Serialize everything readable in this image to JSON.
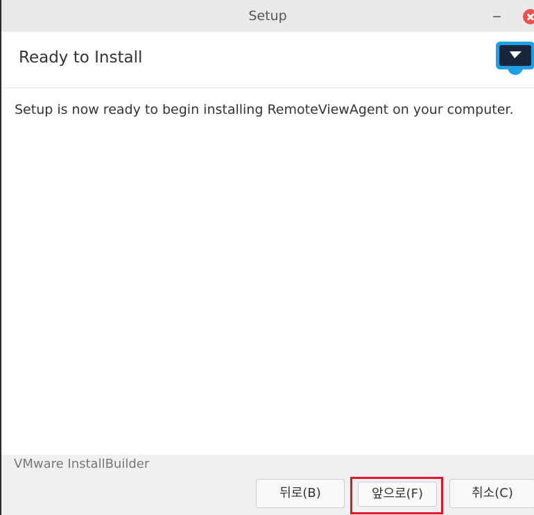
{
  "window": {
    "title": "Setup",
    "minimize_icon": "minimize-icon",
    "close_icon": "close-icon",
    "close_color": "#e8514f"
  },
  "header": {
    "title": "Ready to Install",
    "logo_icon": "remoteview-logo-icon",
    "logo_color": "#1ea0e8"
  },
  "content": {
    "message": "Setup is now ready to begin installing RemoteViewAgent on your computer."
  },
  "footer": {
    "brand": "VMware InstallBuilder",
    "buttons": {
      "back": "뒤로(B)",
      "next": "앞으로(F)",
      "cancel": "취소(C)"
    },
    "highlight_color": "#e0142a"
  }
}
